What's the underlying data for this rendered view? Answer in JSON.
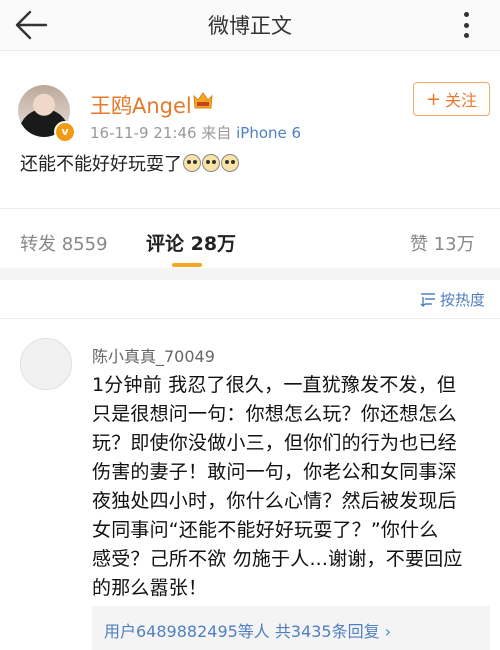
{
  "header": {
    "title": "微博正文"
  },
  "post": {
    "author": "王鸥Angel",
    "timestamp": "16-11-9 21:46",
    "source_prefix": "来自",
    "source": "iPhone 6",
    "follow_label": "关注",
    "text": "还能不能好好玩耍了"
  },
  "tabs": {
    "repost": "转发 8559",
    "comment": "评论 28万",
    "like": "赞 13万"
  },
  "sort": {
    "label": "按热度"
  },
  "comment": {
    "author": "陈小真真_70049",
    "lines": [
      "1分钟前 我忍了很久，一直犹豫发不发，但",
      "只是很想问一句：你想怎么玩？你还想怎么",
      "玩？即使你没做小三，但你们的行为也已经",
      "伤害的妻子！敢问一句，你老公和女同事深",
      "夜独处四小时，你什么心情？然后被发现后",
      "女同事问“还能不能好好玩耍了？”你什么",
      "感受？己所不欲 勿施于人...谢谢，不要回应",
      "的那么嚣张！"
    ],
    "reply_summary": "用户6489882495等人 共3435条回复"
  },
  "icons": {
    "back": "back-arrow-icon",
    "more": "more-vertical-icon",
    "vip": "vip-crown-icon",
    "sort": "sort-icon",
    "reply_chevron": "chevron-right-icon"
  },
  "colors": {
    "accent": "#e8792a",
    "link": "#4f80c0",
    "tab_indicator": "#f5a623"
  }
}
